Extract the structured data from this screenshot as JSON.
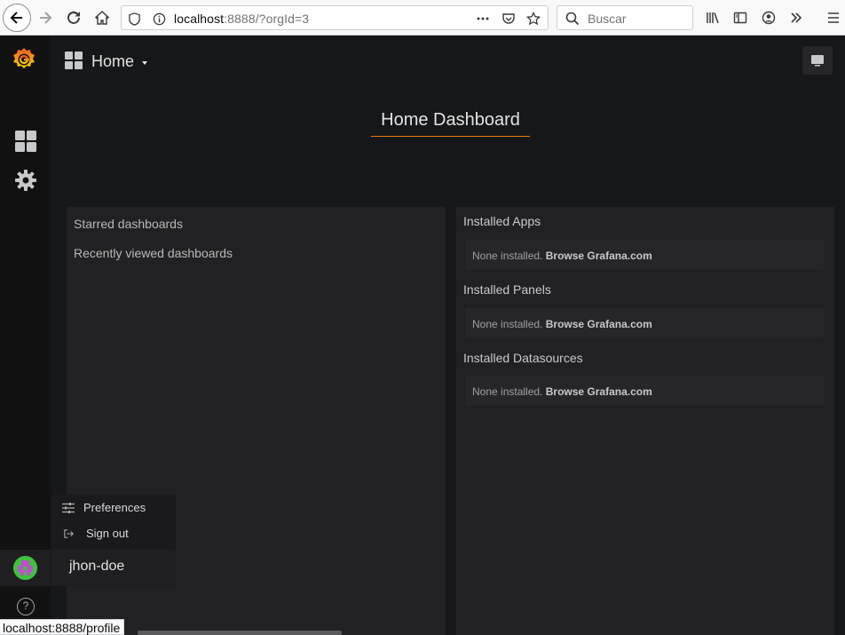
{
  "browser": {
    "url_host": "localhost",
    "url_rest": ":8888/?orgId=3",
    "search_placeholder": "Buscar",
    "status_url": "localhost:8888/profile"
  },
  "sidemenu": {
    "icons": [
      "grafana-logo",
      "dashboards-icon",
      "gear-icon",
      "help-icon"
    ]
  },
  "navbar": {
    "title": "Home"
  },
  "dashboard": {
    "title": "Home Dashboard",
    "left_panel": {
      "starred": "Starred dashboards",
      "recent": "Recently viewed dashboards"
    },
    "right_panel": {
      "sections": [
        {
          "heading": "Installed Apps",
          "none_text": "None installed.",
          "browse_text": "Browse Grafana.com"
        },
        {
          "heading": "Installed Panels",
          "none_text": "None installed.",
          "browse_text": "Browse Grafana.com"
        },
        {
          "heading": "Installed Datasources",
          "none_text": "None installed.",
          "browse_text": "Browse Grafana.com"
        }
      ]
    }
  },
  "profile_menu": {
    "preferences": "Preferences",
    "sign_out": "Sign out",
    "username": "jhon-doe"
  },
  "colors": {
    "accent": "#eb7b18",
    "background": "#161719",
    "panel": "#212124"
  }
}
